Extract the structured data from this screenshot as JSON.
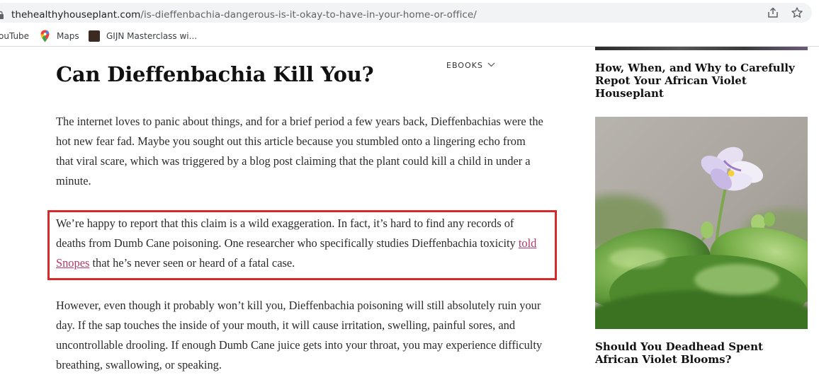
{
  "browser": {
    "url_domain": "thehealthyhouseplant.com",
    "url_path": "/is-dieffenbachia-dangerous-is-it-okay-to-have-in-your-home-or-office/",
    "bookmarks": [
      {
        "label": "ouTube"
      },
      {
        "label": "Maps"
      },
      {
        "label": "GIJN Masterclass wi..."
      }
    ]
  },
  "nav": {
    "ebooks_label": "EBOOKS"
  },
  "article": {
    "title": "Can Dieffenbachia Kill You?",
    "p1": "The internet loves to panic about things, and for a brief period a few years back, Dieffenbachias were the hot new fear fad. Maybe you sought out this article because you stumbled onto a lingering echo from that viral scare, which was triggered by a blog post claiming that the plant could kill a child in under a minute.",
    "p2_before": "We’re happy to report that this claim is a wild exaggeration. In fact, it’s hard to find any records of deaths from Dumb Cane poisoning. One researcher who specifically studies Dieffenbachia toxicity ",
    "p2_link": "told Snopes",
    "p2_after": " that he’s never seen or heard of a fatal case.",
    "p3": "However, even though it probably won’t kill you, Dieffenbachia poisoning will still absolutely ruin your day. If the sap touches the inside of your mouth, it will cause irritation, swelling, painful sores, and uncontrollable drooling. If enough Dumb Cane juice gets into your throat, you may experience difficulty breathing, swallowing, or speaking."
  },
  "sidebar": {
    "related": [
      {
        "title": "How, When, and Why to Carefully Repot Your African Violet Houseplant"
      },
      {
        "title": "Should You Deadhead Spent African Violet Blooms?"
      }
    ]
  },
  "colors": {
    "link": "#b5386a",
    "highlight_border": "#d42a2a",
    "url_bar_bg": "#f1f3f4"
  },
  "icons": [
    "lock-icon",
    "share-icon",
    "star-icon",
    "maps-icon",
    "gijn-favicon",
    "chevron-down-icon"
  ]
}
